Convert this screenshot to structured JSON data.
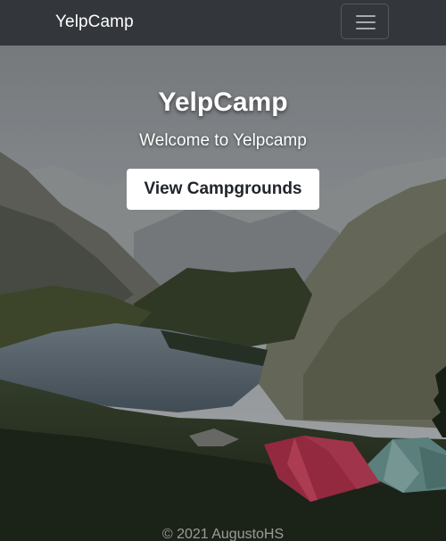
{
  "navbar": {
    "brand": "YelpCamp",
    "toggler_icon": "hamburger-menu-icon"
  },
  "hero": {
    "title": "YelpCamp",
    "subtitle": "Welcome to Yelpcamp",
    "cta_label": "View Campgrounds"
  },
  "footer": {
    "text": "© 2021 AugustoHS"
  },
  "colors": {
    "navbar_bg": "#33363b",
    "button_bg": "#ffffff",
    "text_light": "#ffffff"
  }
}
